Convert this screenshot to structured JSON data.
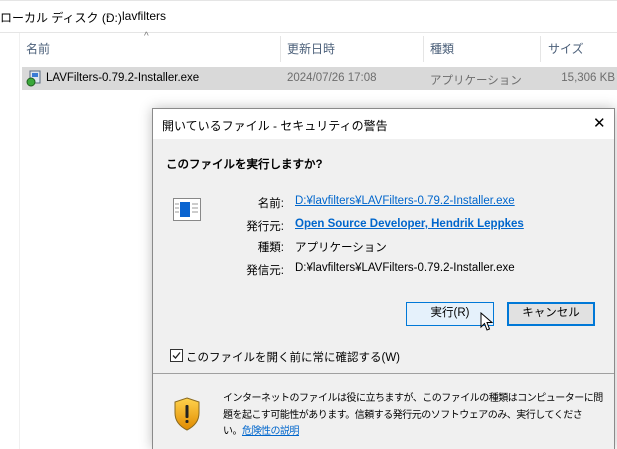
{
  "explorer": {
    "breadcrumb": [
      "ローカル ディスク (D:)",
      "lavfilters"
    ],
    "breadcrumb_sep": "›",
    "sort_indicator": "^",
    "columns": [
      "名前",
      "更新日時",
      "種類",
      "サイズ"
    ],
    "files": [
      {
        "name": "LAVFilters-0.79.2-Installer.exe",
        "modified": "2024/07/26 17:08",
        "type": "アプリケーション",
        "size": "15,306 KB"
      }
    ]
  },
  "dialog": {
    "title": "開いているファイル - セキュリティの警告",
    "close": "✕",
    "question": "このファイルを実行しますか?",
    "fields": [
      {
        "label": "名前:",
        "value": "D:¥lavfilters¥LAVFilters-0.79.2-Installer.exe",
        "link": true
      },
      {
        "label": "発行元:",
        "value": "Open Source Developer, Hendrik Leppkes",
        "link": true
      },
      {
        "label": "種類:",
        "value": "アプリケーション",
        "link": false
      },
      {
        "label": "発信元:",
        "value": "D:¥lavfilters¥LAVFilters-0.79.2-Installer.exe",
        "link": false
      }
    ],
    "run_button": "実行(R)",
    "cancel_button": "キャンセル",
    "checkbox_label": "このファイルを開く前に常に確認する(W)",
    "checkbox_checked": true,
    "warning_line1": "インターネットのファイルは役に立ちますが、このファイルの種類はコンピューターに問",
    "warning_line2": "題を起こす可能性があります。信頼する発行元のソフトウェアのみ、実行してくださ",
    "warning_line3": "い。",
    "risk_link": "危険性の説明"
  }
}
